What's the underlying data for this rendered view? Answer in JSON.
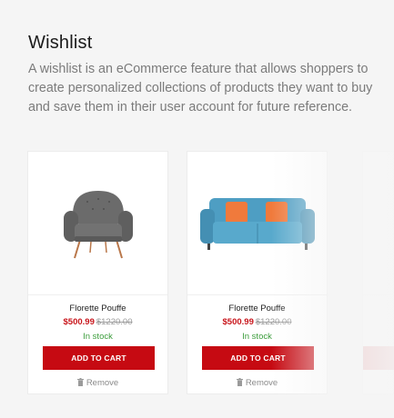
{
  "section": {
    "title": "Wishlist",
    "description": "A wishlist is an eCommerce feature that allows shoppers to create personalized collections of products they want to buy and save them in their user account for future reference."
  },
  "products": [
    {
      "name": "Florette Pouffe",
      "price": "$500.99",
      "old_price": "$1220.00",
      "stock": "In stock",
      "add_label": "ADD TO CART",
      "remove_label": "Remove",
      "image_icon": "armchair-icon"
    },
    {
      "name": "Florette Pouffe",
      "price": "$500.99",
      "old_price": "$1220.00",
      "stock": "In stock",
      "add_label": "ADD TO CART",
      "remove_label": "Remove",
      "image_icon": "sofa-icon"
    }
  ],
  "colors": {
    "accent": "#c60a12",
    "price": "#c8151b",
    "in_stock": "#3c9d3c"
  }
}
